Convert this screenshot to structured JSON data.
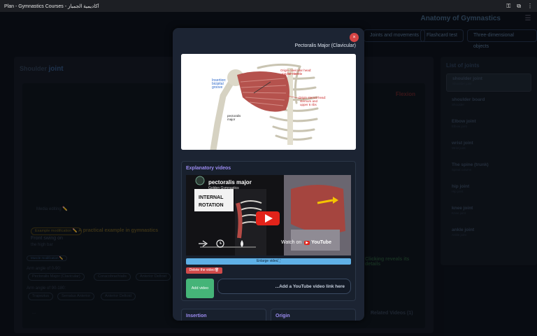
{
  "browser": {
    "title": "Plan - Gymnastics Courses - أكاديمية الجمباز"
  },
  "app": {
    "brand": "Anatomy of Gymnastics",
    "tabs": [
      "Joints and movements",
      "Flashcard test",
      "Three-dimensional objects"
    ]
  },
  "page": {
    "title_prefix": "Shoulder",
    "title_main": "joint",
    "movement": "Flexion",
    "media_editing": "Media editing ✏️",
    "example_label": "Example modification ✏️",
    "example_title": "A practical example in gymnastics",
    "example_text": "Front swing on",
    "example_sub": "the high bar",
    "reveal_hint": "Clicking reveals its details",
    "muscle_edit_label": "Muscle modification ✏️",
    "range1_label": "Arm angle of 0-90:",
    "range1_chips": [
      "Pectoralis Major (Clavicular)",
      "Coracobrachialis",
      "Anterior Deltoid"
    ],
    "range2_label": "Arm angle of 90-180:",
    "range2_chips": [
      "Trapezius",
      "Serratus Anterior",
      "Anterior Deltoid"
    ],
    "related_videos": "Related Videos (1)",
    "ellipsis": "..."
  },
  "joints": {
    "title": "List of joints",
    "items": [
      {
        "name": "shoulder joint",
        "sub": "Shoulder joint"
      },
      {
        "name": "shoulder board",
        "sub": "Shoulder"
      },
      {
        "name": "Elbow joint",
        "sub": "Elbow joint"
      },
      {
        "name": "wrist joint",
        "sub": "Wrist joint"
      },
      {
        "name": "The spine (trunk)",
        "sub": "Spinal column"
      },
      {
        "name": "hip joint",
        "sub": "Hip joint"
      },
      {
        "name": "knee joint",
        "sub": "Knee joint"
      },
      {
        "name": "ankle joint",
        "sub": "Ankle joint"
      }
    ]
  },
  "modal": {
    "close": "×",
    "title": "Pectoralis Major (Clavicular)",
    "diagram": {
      "insertion": "Insertion:\nbicipital\ngroove",
      "clav_head": "Origin clavicular head:\nmedial clavicle",
      "sternal_head": "Origin sternal head:\nsternum and\nupper 6 ribs",
      "pm_label": "pectoralis\nmajor"
    },
    "videos_title": "Explanatory videos",
    "video": {
      "channel_title": "pectoralis major",
      "channel_sub": "Golden Gymnastics",
      "overlay_line1": "INTERNAL",
      "overlay_line2": "ROTATION",
      "watch_on": "Watch on",
      "youtube": "YouTube"
    },
    "enlarge": "Enlarge video⛶",
    "delete": "Delete the video🗑",
    "add_button": "Add video",
    "add_input_value": "...Add a YouTube video link here",
    "insertion": "Insertion",
    "origin": "Origin"
  },
  "colors": {
    "accent_purple": "#9c8cf2",
    "green": "#45b478",
    "red": "#d04a4a",
    "blue": "#5fb0e6"
  }
}
